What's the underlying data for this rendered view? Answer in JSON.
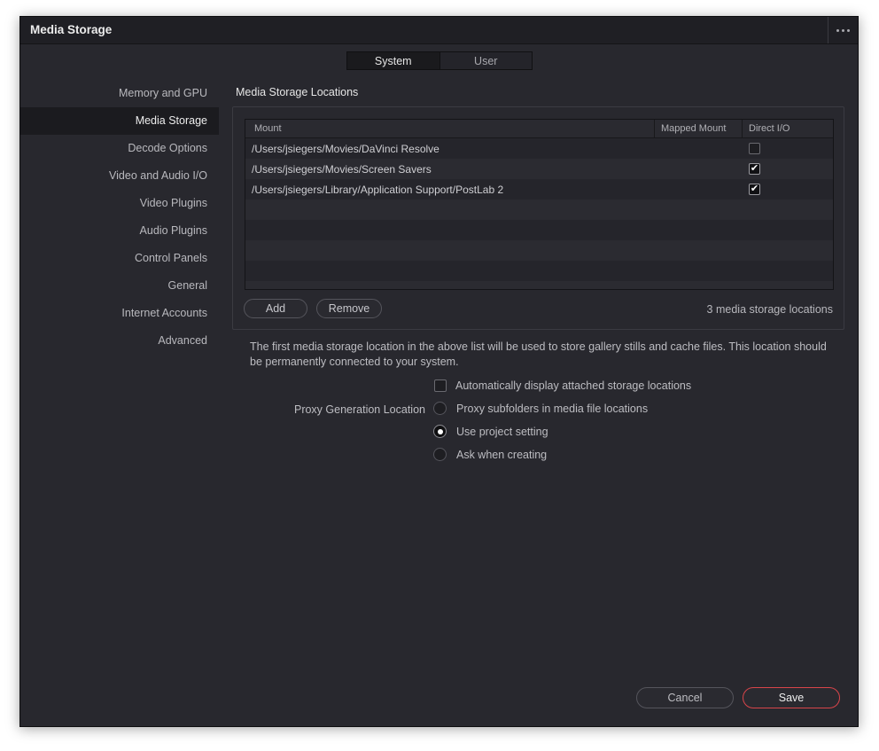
{
  "window": {
    "title": "Media Storage"
  },
  "tabs": [
    {
      "label": "System",
      "active": true
    },
    {
      "label": "User",
      "active": false
    }
  ],
  "sidebar": {
    "items": [
      {
        "label": "Memory and GPU"
      },
      {
        "label": "Media Storage",
        "active": true
      },
      {
        "label": "Decode Options"
      },
      {
        "label": "Video and Audio I/O"
      },
      {
        "label": "Video Plugins"
      },
      {
        "label": "Audio Plugins"
      },
      {
        "label": "Control Panels"
      },
      {
        "label": "General"
      },
      {
        "label": "Internet Accounts"
      },
      {
        "label": "Advanced"
      }
    ]
  },
  "storage": {
    "section_title": "Media Storage Locations",
    "columns": [
      "Mount",
      "Mapped Mount",
      "Direct I/O"
    ],
    "rows": [
      {
        "mount": "/Users/jsiegers/Movies/DaVinci Resolve",
        "mapped": "",
        "direct_io": false
      },
      {
        "mount": "/Users/jsiegers/Movies/Screen Savers",
        "mapped": "",
        "direct_io": true
      },
      {
        "mount": "/Users/jsiegers/Library/Application Support/PostLab 2",
        "mapped": "",
        "direct_io": true
      }
    ],
    "add_label": "Add",
    "remove_label": "Remove",
    "count_text": "3 media storage locations"
  },
  "note": "The first media storage location in the above list will be used to store gallery stills and cache files. This location should be permanently connected to your system.",
  "options": {
    "auto_display_label": "Automatically display attached storage locations",
    "auto_display_checked": false,
    "proxy_label": "Proxy Generation Location",
    "proxy_choices": [
      {
        "label": "Proxy subfolders in media file locations",
        "selected": false
      },
      {
        "label": "Use project setting",
        "selected": true
      },
      {
        "label": "Ask when creating",
        "selected": false
      }
    ]
  },
  "footer": {
    "cancel_label": "Cancel",
    "save_label": "Save"
  },
  "colors": {
    "background": "#28282e",
    "accent": "#d8454a"
  }
}
